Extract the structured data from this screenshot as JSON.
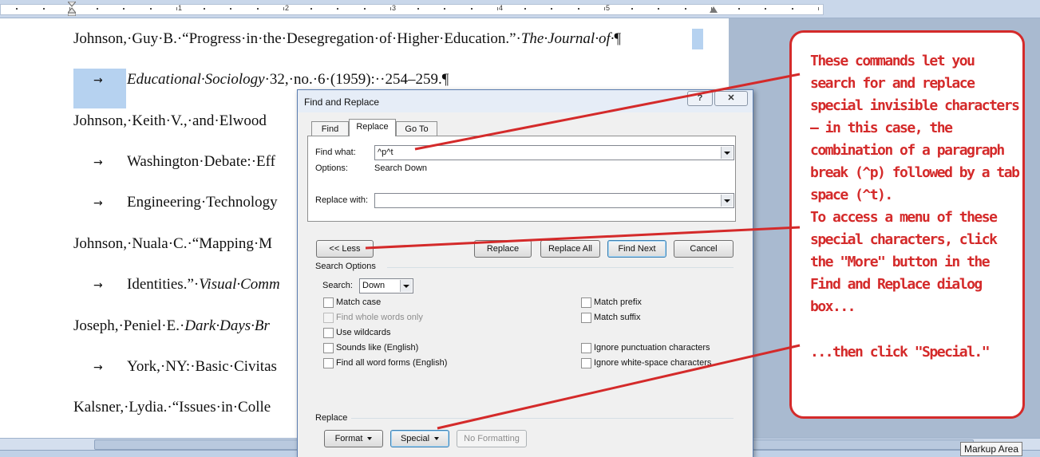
{
  "ruler": {
    "numbers": [
      "1",
      "2",
      "3",
      "4",
      "5"
    ]
  },
  "document": {
    "lines": [
      {
        "plain": "Johnson,·Guy·B.·“Progress·in·the·Desegregation·of·Higher·Education.”·",
        "italic": "The·Journal·of·",
        "end": "¶"
      },
      {
        "italic": "Educational·Sociology",
        "plain": "·32,·no.·6·(1959):··254–259.¶"
      },
      {
        "plain": "Johnson,·Keith·V.,·and·Elwood"
      },
      {
        "plain": "Washington·Debate:·Eff"
      },
      {
        "plain": "Engineering·Technology"
      },
      {
        "plain": "Johnson,·Nuala·C.·“Mapping·M"
      },
      {
        "plain": "Identities.”·",
        "italic": "Visual·Comm"
      },
      {
        "plain": "Joseph,·Peniel·E.·",
        "italic": "Dark·Days·Br"
      },
      {
        "plain": "York,·NY:·Basic·Civitas"
      },
      {
        "plain": "Kalsner,·Lydia.·“Issues·in·Colle"
      }
    ],
    "tab_glyph": "→"
  },
  "status": {
    "tooltip": "Markup Area"
  },
  "dialog": {
    "title": "Find and Replace",
    "help_label": "?",
    "close_label": "✕",
    "tabs": [
      "Find",
      "Replace",
      "Go To"
    ],
    "find_what_label": "Find what:",
    "find_what_value": "^p^t",
    "options_label": "Options:",
    "options_value": "Search Down",
    "replace_with_label": "Replace with:",
    "replace_with_value": "",
    "buttons": {
      "less": "<< Less",
      "replace": "Replace",
      "replace_all": "Replace All",
      "find_next": "Find Next",
      "cancel": "Cancel"
    },
    "search_options_label": "Search Options",
    "search_label": "Search:",
    "search_value": "Down",
    "checkboxes_left": [
      "Match case",
      "Find whole words only",
      "Use wildcards",
      "Sounds like (English)",
      "Find all word forms (English)"
    ],
    "checkboxes_right": [
      "Match prefix",
      "Match suffix",
      "Ignore punctuation characters",
      "Ignore white-space characters"
    ],
    "replace_section_label": "Replace",
    "format_button": "Format",
    "special_button": "Special",
    "no_formatting_button": "No Formatting"
  },
  "callout": {
    "paragraph1": "These commands let you search for and replace special invisible characters — in this case, the combination of a paragraph break (^p) followed by a tab space (^t).",
    "paragraph2": "To access a menu of these special characters, click the \"More\" button in the Find and Replace dialog box...",
    "paragraph3": "...then click \"Special.\"",
    "color": "#d42a2a"
  },
  "colors": {
    "selection": "#b6d2f0",
    "workspace": "#a9bad0",
    "callout_red": "#d42a2a"
  }
}
